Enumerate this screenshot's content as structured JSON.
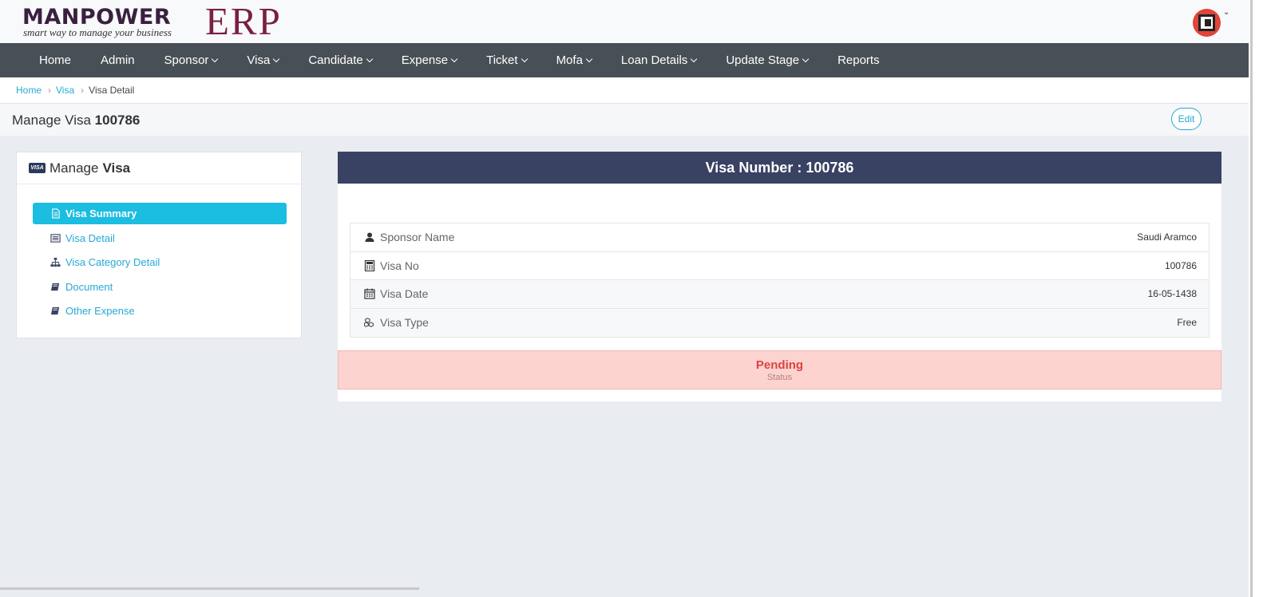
{
  "brand": {
    "main": "MANPOWER",
    "erp": "ERP",
    "tagline": "smart way to manage your business"
  },
  "nav": {
    "items": [
      {
        "label": "Home",
        "has_caret": false
      },
      {
        "label": "Admin",
        "has_caret": false
      },
      {
        "label": "Sponsor",
        "has_caret": true
      },
      {
        "label": "Visa",
        "has_caret": true
      },
      {
        "label": "Candidate",
        "has_caret": true
      },
      {
        "label": "Expense",
        "has_caret": true
      },
      {
        "label": "Ticket",
        "has_caret": true
      },
      {
        "label": "Mofa",
        "has_caret": true
      },
      {
        "label": "Loan Details",
        "has_caret": true
      },
      {
        "label": "Update Stage",
        "has_caret": true
      },
      {
        "label": "Reports",
        "has_caret": false
      }
    ]
  },
  "breadcrumb": {
    "home": "Home",
    "visa": "Visa",
    "current": "Visa Detail",
    "separator": "›"
  },
  "page": {
    "title_prefix": "Manage Visa",
    "title_number": "100786",
    "edit_label": "Edit"
  },
  "left_panel": {
    "card_icon_text": "VISA",
    "title_prefix": "Manage",
    "title_bold": "Visa",
    "menu": [
      {
        "label": "Visa Summary",
        "icon": "file-icon",
        "active": true
      },
      {
        "label": "Visa Detail",
        "icon": "list-icon",
        "active": false
      },
      {
        "label": "Visa Category Detail",
        "icon": "sitemap-icon",
        "active": false
      },
      {
        "label": "Document",
        "icon": "book-icon",
        "active": false
      },
      {
        "label": "Other Expense",
        "icon": "book-icon",
        "active": false
      }
    ]
  },
  "right_panel": {
    "header": "Visa Number : 100786",
    "rows": [
      {
        "label": "Sponsor Name",
        "value": "Saudi Aramco",
        "icon": "user-icon"
      },
      {
        "label": "Visa No",
        "value": "100786",
        "icon": "calculator-icon"
      },
      {
        "label": "Visa Date",
        "value": "16-05-1438",
        "icon": "calendar-icon"
      },
      {
        "label": "Visa Type",
        "value": "Free",
        "icon": "cubes-icon"
      }
    ],
    "status": {
      "value": "Pending",
      "label": "Status"
    }
  },
  "colors": {
    "nav_bg": "#494f56",
    "accent": "#1bbde0",
    "link": "#26a9d4",
    "panel_header": "#3a4263",
    "status_bg": "#fdd3d0",
    "status_text": "#d9443f",
    "brand_dark": "#3a2040",
    "brand_erp": "#7a1f45"
  }
}
